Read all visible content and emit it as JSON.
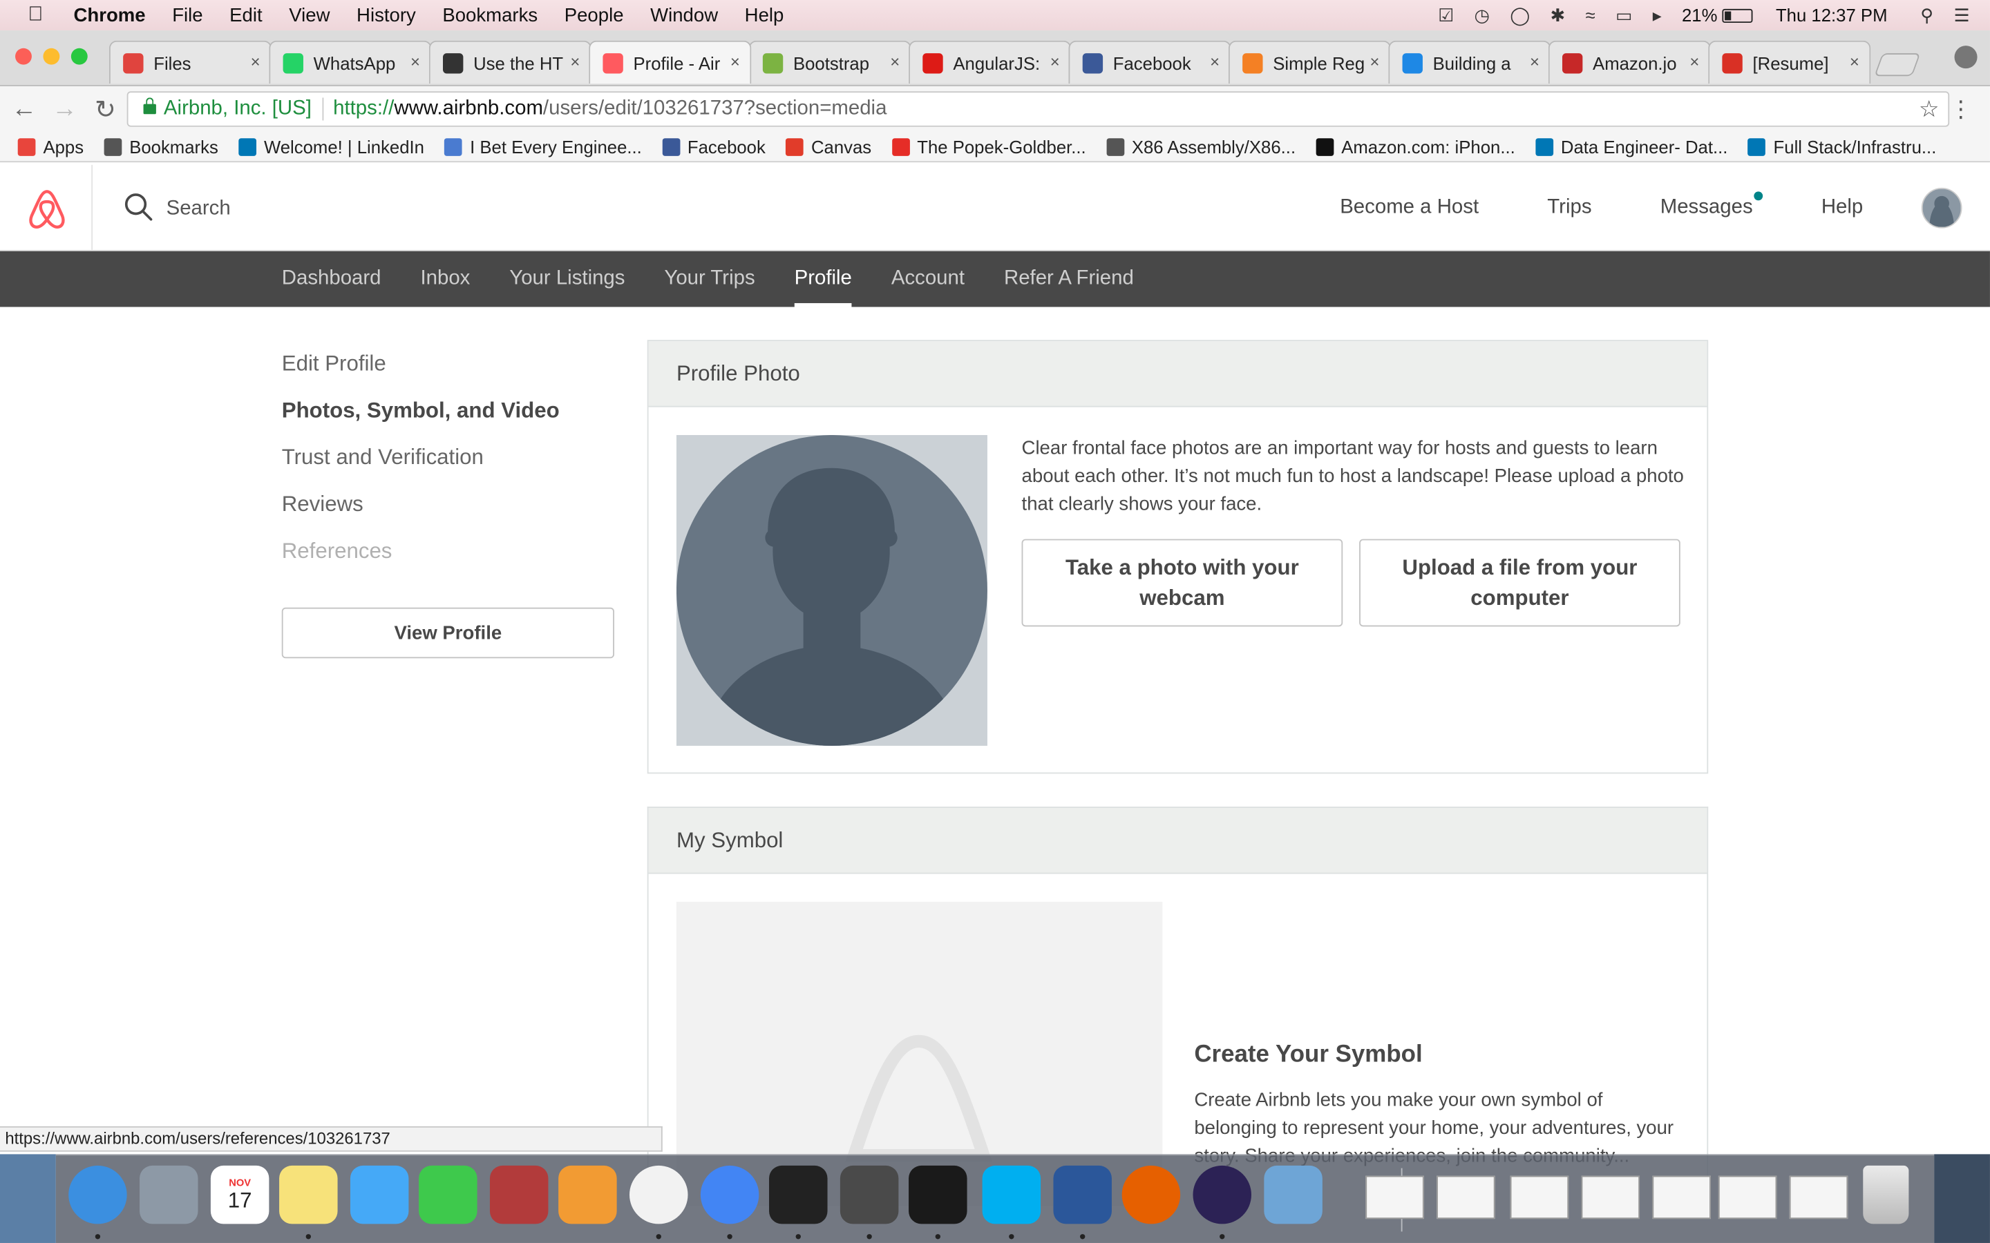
{
  "menubar": {
    "app": "Chrome",
    "items": [
      "File",
      "Edit",
      "View",
      "History",
      "Bookmarks",
      "People",
      "Window",
      "Help"
    ],
    "battery": "21%",
    "clock": "Thu 12:37 PM"
  },
  "tabs": [
    {
      "label": "Files",
      "icon_color": "#e0443e",
      "icon": "gear-icon"
    },
    {
      "label": "WhatsApp",
      "icon_color": "#25d366",
      "icon": "whatsapp-icon"
    },
    {
      "label": "Use the HT",
      "icon_color": "#333333",
      "icon": "dark-page-icon"
    },
    {
      "label": "Profile - Air",
      "icon_color": "#ff5a5f",
      "icon": "airbnb-icon",
      "active": true
    },
    {
      "label": "Bootstrap",
      "icon_color": "#7cb342",
      "icon": "bootstrap-icon"
    },
    {
      "label": "AngularJS:",
      "icon_color": "#dd1b16",
      "icon": "angular-icon"
    },
    {
      "label": "Facebook",
      "icon_color": "#3b5998",
      "icon": "facebook-icon"
    },
    {
      "label": "Simple Reg",
      "icon_color": "#f48024",
      "icon": "stackoverflow-icon"
    },
    {
      "label": "Building a",
      "icon_color": "#1e88e5",
      "icon": "c-icon"
    },
    {
      "label": "Amazon.jo",
      "icon_color": "#c62828",
      "icon": "info-icon"
    },
    {
      "label": "[Resume]",
      "icon_color": "#d93025",
      "icon": "gmail-icon"
    }
  ],
  "toolbar": {
    "secure_label": "Airbnb, Inc. [US]",
    "url_scheme": "https://",
    "url_host": "www.airbnb.com",
    "url_path": "/users/edit/103261737?section=media"
  },
  "bookmarks": [
    {
      "label": "Apps",
      "icon": "apps-grid-icon",
      "color": "#e8453c"
    },
    {
      "label": "Bookmarks",
      "icon": "star-icon",
      "color": "#555555"
    },
    {
      "label": "Welcome! | LinkedIn",
      "icon": "linkedin-icon",
      "color": "#0077b5"
    },
    {
      "label": "I Bet Every Enginee...",
      "icon": "link-icon",
      "color": "#4a7bd0"
    },
    {
      "label": "Facebook",
      "icon": "facebook-icon",
      "color": "#3b5998"
    },
    {
      "label": "Canvas",
      "icon": "canvas-icon",
      "color": "#e13c2a"
    },
    {
      "label": "The Popek-Goldber...",
      "icon": "youtube-icon",
      "color": "#e52d27"
    },
    {
      "label": "X86 Assembly/X86...",
      "icon": "wikibooks-icon",
      "color": "#555555"
    },
    {
      "label": "Amazon.com: iPhon...",
      "icon": "amazon-icon",
      "color": "#111111"
    },
    {
      "label": "Data Engineer- Dat...",
      "icon": "linkedin-icon",
      "color": "#0077b5"
    },
    {
      "label": "Full Stack/Infrastru...",
      "icon": "linkedin-icon",
      "color": "#0077b5"
    }
  ],
  "header": {
    "search_placeholder": "Search",
    "nav": [
      "Become a Host",
      "Trips",
      "Messages",
      "Help"
    ],
    "brand_color": "#ff5a5f",
    "notification_color": "#008489"
  },
  "subnav": {
    "items": [
      "Dashboard",
      "Inbox",
      "Your Listings",
      "Your Trips",
      "Profile",
      "Account",
      "Refer A Friend"
    ],
    "active": "Profile"
  },
  "sidebar": {
    "items": [
      "Edit Profile",
      "Photos, Symbol, and Video",
      "Trust and Verification",
      "Reviews",
      "References"
    ],
    "active": "Photos, Symbol, and Video",
    "view_profile": "View Profile"
  },
  "profile_photo": {
    "title": "Profile Photo",
    "description": "Clear frontal face photos are an important way for hosts and guests to learn about each other. It’s not much fun to host a landscape! Please upload a photo that clearly shows your face.",
    "webcam_button": "Take a photo with your webcam",
    "upload_button": "Upload a file from your computer"
  },
  "symbol": {
    "title": "My Symbol",
    "create_title": "Create Your Symbol",
    "description": "Create Airbnb lets you make your own symbol of belonging to represent your home, your adventures, your story. Share your experiences, join the community..."
  },
  "statusbar": "https://www.airbnb.com/users/references/103261737",
  "dock": [
    {
      "name": "finder-icon",
      "color": "#3b8fe0"
    },
    {
      "name": "launchpad-icon",
      "color": "#8d99a6"
    },
    {
      "name": "calendar-icon",
      "color": "#ffffff"
    },
    {
      "name": "notes-icon",
      "color": "#f7e27a"
    },
    {
      "name": "messages-icon",
      "color": "#45a9f7"
    },
    {
      "name": "facetime-icon",
      "color": "#3ec94c"
    },
    {
      "name": "photo-booth-icon",
      "color": "#b23b3b"
    },
    {
      "name": "pages-icon",
      "color": "#f29b33"
    },
    {
      "name": "photos-icon",
      "color": "#f2f2f2"
    },
    {
      "name": "chrome-icon",
      "color": "#4285f4"
    },
    {
      "name": "terminal-icon",
      "color": "#222222"
    },
    {
      "name": "sublime-icon",
      "color": "#4a4a4a"
    },
    {
      "name": "intellij-icon",
      "color": "#1a1a1a"
    },
    {
      "name": "skype-icon",
      "color": "#00aff0"
    },
    {
      "name": "word-icon",
      "color": "#2b579a"
    },
    {
      "name": "firefox-icon",
      "color": "#e66000"
    },
    {
      "name": "eclipse-icon",
      "color": "#2c2255"
    },
    {
      "name": "preview-icon",
      "color": "#6ea5d6"
    }
  ],
  "dock_calendar": {
    "month": "NOV",
    "day": "17"
  }
}
